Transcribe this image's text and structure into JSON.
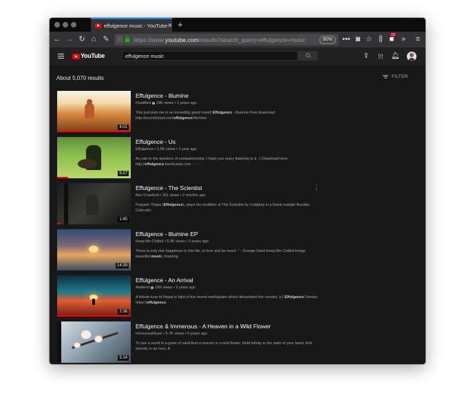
{
  "browser": {
    "tab_title": "effulgence music - YouTube",
    "tab_close": "✕",
    "new_tab": "+",
    "url_prefix": "https://www.",
    "url_domain": "youtube.com",
    "url_suffix": "/results?search_query=effulgence+music",
    "zoom": "80%",
    "notification_count": "10"
  },
  "youtube": {
    "logo_text": "YouTube",
    "search_value": "effulgence music"
  },
  "results": {
    "count_label": "About 5,070 results",
    "filter_label": "FILTER",
    "items": [
      {
        "title": "Effulgence - Illumine",
        "channel": "Fluidified",
        "verified": true,
        "meta": "29K views • 3 years ago",
        "desc_pre": "This just puts me in an incredibly good mood! ",
        "desc_bold": "Effulgence",
        "desc_mid": " - Illumine Free download: http://soundcloud.com/",
        "desc_bold2": "effulgence",
        "desc_post": "/illumine",
        "duration": "4:01",
        "progress": 1.0
      },
      {
        "title": "Effulgence - Us",
        "channel": "Effulgence",
        "verified": false,
        "meta": "1.5K views • 1 year ago",
        "desc_pre": "An ode to the wonders of companionship. I hope you enjoy listening to it. :) Download here: http://",
        "desc_bold": "effulgence",
        "desc_mid": ".bandcamp.com - - - - -",
        "desc_bold2": "",
        "desc_post": "",
        "duration": "5:27",
        "progress": 0.15
      },
      {
        "title": "Effulgence - The Scientist",
        "channel": "Ben Crawford",
        "verified": false,
        "meta": "161 views • 2 months ago",
        "desc_pre": "Prayash Thapa (",
        "desc_bold": "Effulgence",
        "desc_mid": "), plays his rendition of The Scientist by Coldplay in a forest outside Boulder, Colorado.",
        "desc_bold2": "",
        "desc_post": "",
        "duration": "1:45",
        "progress": 0.05
      },
      {
        "title": "Effulgence - Illumine EP",
        "channel": "Keep Me Chilled",
        "verified": false,
        "meta": "5.9K views • 3 years ago",
        "desc_pre": "There is only one happiness in this life, to love and be loved. \" - George Sand Keep Me Chilled brings beautiful ",
        "desc_bold": "music",
        "desc_mid": ", inspiring",
        "desc_bold2": "",
        "desc_post": "",
        "duration": "14:39",
        "progress": 0
      },
      {
        "title": "Effulgence - An Arrival",
        "channel": "Ambient",
        "verified": true,
        "meta": "15K views • 2 years ago",
        "desc_pre": "A tribute tune to Nepal in light of the recent earthquake which devastated the country. (c) ",
        "desc_bold": "Effulgence",
        "desc_mid": " Donate: https://",
        "desc_bold2": "effulgence",
        "desc_post": ".",
        "duration": "2:38",
        "progress": 1.0
      },
      {
        "title": "Effulgence & Immensus - A Heaven in a Wild Flower",
        "channel": "ImmersusMusic",
        "verified": false,
        "meta": "5.7K views • 5 years ago",
        "desc_pre": "To see a world in a grain of sand And a heaven in a wild flower, Hold infinity in the palm of your hand, And eternity in an hour. A",
        "desc_bold": "",
        "desc_mid": "",
        "desc_bold2": "",
        "desc_post": "",
        "duration": "5:14",
        "progress": 0
      }
    ]
  },
  "colors": {
    "accent_red": "#ff0000",
    "background": "#181818",
    "header": "#202020"
  },
  "icons": [
    "back-arrow-icon",
    "forward-arrow-icon",
    "reload-icon",
    "home-icon",
    "wrench-icon",
    "info-icon",
    "lock-icon",
    "more-dots-icon",
    "pocket-icon",
    "bookmark-star-icon",
    "library-icon",
    "shield-extension-icon",
    "overflow-icon",
    "menu-icon",
    "hamburger-icon",
    "youtube-logo",
    "search-icon",
    "upload-icon",
    "apps-grid-icon",
    "bell-icon",
    "avatar",
    "filter-icon",
    "more-vert-icon"
  ]
}
